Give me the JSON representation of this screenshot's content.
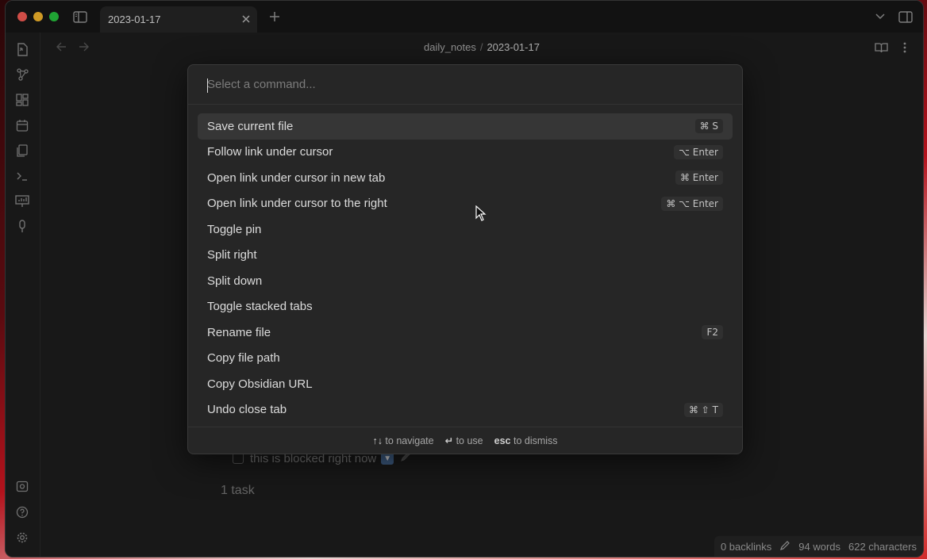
{
  "tab": {
    "title": "2023-01-17"
  },
  "breadcrumb": {
    "folder": "daily_notes",
    "separator": "/",
    "file": "2023-01-17"
  },
  "palette": {
    "placeholder": "Select a command...",
    "commands": [
      {
        "label": "Save current file",
        "hotkey": "⌘ S"
      },
      {
        "label": "Follow link under cursor",
        "hotkey": "⌥ Enter"
      },
      {
        "label": "Open link under cursor in new tab",
        "hotkey": "⌘ Enter"
      },
      {
        "label": "Open link under cursor to the right",
        "hotkey": "⌘ ⌥ Enter"
      },
      {
        "label": "Toggle pin",
        "hotkey": ""
      },
      {
        "label": "Split right",
        "hotkey": ""
      },
      {
        "label": "Split down",
        "hotkey": ""
      },
      {
        "label": "Toggle stacked tabs",
        "hotkey": ""
      },
      {
        "label": "Rename file",
        "hotkey": "F2"
      },
      {
        "label": "Copy file path",
        "hotkey": ""
      },
      {
        "label": "Copy Obsidian URL",
        "hotkey": ""
      },
      {
        "label": "Undo close tab",
        "hotkey": "⌘ ⇧ T"
      }
    ],
    "footer": {
      "navigate_key": "↑↓",
      "navigate_label": "to navigate",
      "use_key": "↵",
      "use_label": "to use",
      "dismiss_key": "esc",
      "dismiss_label": "to dismiss"
    }
  },
  "note": {
    "task_text": "this is blocked right now",
    "task_count": "1 task"
  },
  "status": {
    "backlinks": "0 backlinks",
    "words": "94 words",
    "characters": "622 characters"
  },
  "colors": {
    "accent_selected": "#363636",
    "background": "#1e1e1e"
  }
}
